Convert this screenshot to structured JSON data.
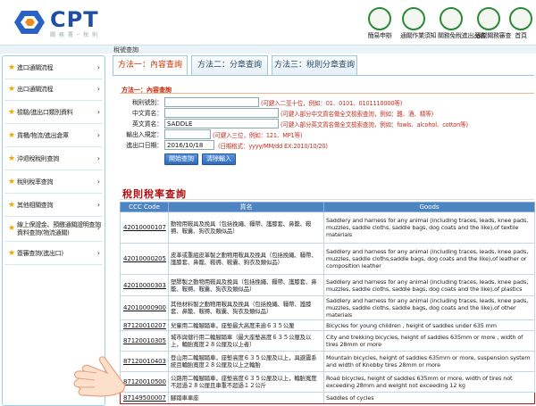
{
  "header": {
    "logo_text": "CPT",
    "logo_sub": "關 務 署 ─ 稅 則",
    "icons": [
      {
        "name": "simple-apply-icon",
        "label": "簡易申辦"
      },
      {
        "name": "customs-announce-icon",
        "label": "通關作業須知"
      },
      {
        "name": "trade-register-icon",
        "label": "關務免稅進出品名"
      },
      {
        "name": "reduce-exempt-icon",
        "label": "通關關務審查"
      },
      {
        "name": "home-icon",
        "label": "首頁"
      }
    ]
  },
  "breadcrumb": "稅號查詢",
  "sidebar": {
    "items": [
      {
        "label": "進口通關流程"
      },
      {
        "label": "出口通關流程"
      },
      {
        "label": "檢驗/進出口類別資料"
      },
      {
        "label": "貨櫃/物流/進出倉庫"
      },
      {
        "label": "沖退稅稅則查詢"
      },
      {
        "label": "稅則稅率查詢"
      },
      {
        "label": "其他相關查詢"
      },
      {
        "label": "線上保證金、預繳通關證明查詢",
        "line2": "資料查詢(物流通關)"
      },
      {
        "label": "簽審查詢(進出口)"
      }
    ]
  },
  "tabs": [
    {
      "label": "方法一：內容查詢"
    },
    {
      "label": "方法二：分章查詢"
    },
    {
      "label": "方法三：稅則分章查詢"
    }
  ],
  "form": {
    "section_title": "方法一：內容查詢",
    "fields": [
      {
        "label": "稅則號別：",
        "value": "",
        "hint": "(可鍵入二至十位，例如：01、0101、0101110000等)"
      },
      {
        "label": "中文貨名：",
        "value": "",
        "hint": "(可鍵入部分中文貨名做全文檢索查詢，例如：雞、酒、精等)"
      },
      {
        "label": "英文貨名：",
        "value": "SADDLE",
        "hint": "(可鍵入部分英文貨名做全文檢索查詢，例如：fowls、alcohol、cotton等)"
      },
      {
        "label": "輸出入規定：",
        "value": "",
        "hint": "(可鍵入三位，例如：121、MP1等)"
      },
      {
        "label": "進出口日期：",
        "value": "2016/10/18",
        "hint": "(日期格式：yyyy/MM/dd EX:2010/10/20)"
      }
    ],
    "search_button": "開始查詢",
    "clear_button": "清除輸入"
  },
  "results": {
    "title": "稅則稅率查詢",
    "columns": [
      "CCC Code",
      "貨名",
      "Goods"
    ],
    "rows": [
      {
        "code": "42010000107",
        "name": "動物用鞍具及挽具（包括挽繩、韁帶、護膝套、鼻籠、鞍褥、鞍囊、狗衣及類似品）",
        "goods": "Saddlery and harness for any animal (including traces, leads, knee pads, muzzles, saddle cloths, saddle bags, dog coats and the like),of textile materials"
      },
      {
        "code": "42010000205",
        "name": "皮革或重組皮革製之動物用鞍具及挽具（包括挽繩、韁帶、護膝套、鼻籠、鞍褥、鞍囊、狗衣及類似品）",
        "goods": "Saddlery and harness for any animal (including traces, leads, knee pads, muzzles, saddle cloths,saddle bags, dog coats and the like),of leather or composition leather"
      },
      {
        "code": "42010000303",
        "name": "塑膠製之動物用鞍具及挽具（包括挽繩、韁帶、護膝套、鼻籠、鞍褥、鞍囊、狗衣及類似品）",
        "goods": "Saddlery and harness for any animal (including traces, leads, knee pads, muzzles, saddle cloths, saddle bags, dog coats and the like),of plastics"
      },
      {
        "code": "42010000900",
        "name": "其他材料製之動物用鞍具及挽具（包括挽繩、韁帶、護膝套、鼻籠、鞍褥、鞍囊、狗衣及類似品）",
        "goods": "Saddlery and harness for any animal (including traces, leads, knee pads, muzzles, saddle cloths, saddle bags, dog coats and the like),of other materials"
      },
      {
        "code": "87120010207",
        "name": "兒童用二輪腳踏車，座墊最大高度未逾６３５公厘",
        "goods": "Bicycles for young children , height of saddles under 635 mm"
      },
      {
        "code": "87120010305",
        "name": "城市與健行用二輪腳踏車（最大座墊高度６３５公厘及以上，輪胎寬度２８公厘及以上者）",
        "goods": "City and trekking bicycles, height of saddles 635mm or more , width of tires 28mm or more"
      },
      {
        "code": "87120010403",
        "name": "登山用二輪腳踏車，座墊高度６３５公厘及以上，具避震系統且輪胎寬度２８公厘及以上之輪胎",
        "goods": "Mountain bicycles, height of saddles 635mm or more, suspension system and width of Knobby tires 28mm or more"
      },
      {
        "code": "87120010500",
        "name": "公路用二輪腳踏車，座墊高度６３５公厘及以上，輪胎寬度不超過２８公厘且車重不超過１２公斤",
        "goods": "Road bicycles, height of saddles 635mm or more, width of tires not exceeding 28mm and weight not exceeding 12 kg"
      },
      {
        "code": "87149500007",
        "name": "腳踏車車座",
        "goods": "Saddles of cycles"
      }
    ]
  }
}
